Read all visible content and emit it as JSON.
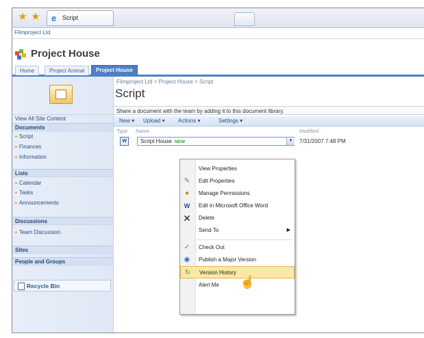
{
  "browser": {
    "tab_title": "Script",
    "icons": [
      "favorites-star-icon",
      "add-favorite-star-icon",
      "ie-page-icon"
    ]
  },
  "site": {
    "parent_name": "Filmproject Ltd",
    "title": "Project House",
    "top_nav": [
      "Home",
      "Project Animal",
      "Project House"
    ]
  },
  "leftnav": {
    "view_all": "View All Site Content",
    "documents_heading": "Documents",
    "documents": [
      "Script",
      "Finances",
      "Information"
    ],
    "lists_heading": "Lists",
    "lists": [
      "Calendar",
      "Tasks",
      "Announcements"
    ],
    "discussions_heading": "Discussions",
    "discussions": [
      "Team Discussion"
    ],
    "sites_heading": "Sites",
    "people_heading": "People and Groups",
    "recycle_bin": "Recycle Bin"
  },
  "main": {
    "breadcrumb": "Filmproject Ltd > Project House > Script",
    "page_title": "Script",
    "description": "Share a document with the team by adding it to this document library.",
    "toolbar": {
      "new": "New",
      "upload": "Upload",
      "actions": "Actions",
      "settings": "Settings"
    },
    "columns": {
      "type": "Type",
      "name": "Name",
      "modified": "Modified"
    },
    "document": {
      "name": "Script House",
      "new_badge": "NEW",
      "modified": "7/31/2007 7:48 PM"
    }
  },
  "context_menu": {
    "items": [
      "View Properties",
      "Edit Properties",
      "Manage Permissions",
      "Edit in Microsoft Office Word",
      "Delete",
      "Send To",
      "Check Out",
      "Publish a Major Version",
      "Version History",
      "Alert Me"
    ],
    "highlighted": "Version History"
  },
  "colors": {
    "accent": "#4f7fc4",
    "highlight": "#fbe8a6",
    "nav_bg": "#e7eef8"
  }
}
